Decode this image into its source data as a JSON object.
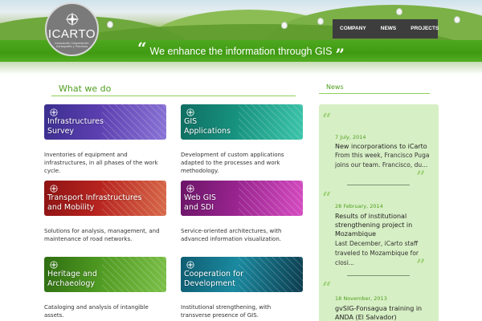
{
  "header": {
    "logo_text": "ICARTO",
    "logo_subtitle": "Innovación Cooperación Cartografía y Procesos",
    "nav": [
      "COMPANY",
      "NEWS",
      "PROJECTS"
    ],
    "slogan": "We enhance the information through GIS",
    "quote_open": "“",
    "quote_close": "”"
  },
  "what_we_do": {
    "title": "What we do",
    "cards": [
      {
        "label": "Infrastructures\nSurvey",
        "description": "Inventories of equipment and infrastructures, in all phases of the work cycle."
      },
      {
        "label": "GIS\nApplications",
        "description": "Development of custom applications adapted to the processes and work methodology."
      },
      {
        "label": "Transport Infrastructures\nand Mobility",
        "description": "Solutions for analysis, management, and maintenance of road networks."
      },
      {
        "label": "Web GIS\nand SDI",
        "description": "Service-oriented architectures, with advanced information visualization."
      },
      {
        "label": "Heritage and\nArchaeology",
        "description": "Cataloging and analysis of intangible assets."
      },
      {
        "label": "Cooperation for\nDevelopment",
        "description": "Institutional strengthening, with transverse presence of GIS."
      }
    ]
  },
  "news": {
    "title": "News",
    "quote_open": "“",
    "quote_close": "”",
    "items": [
      {
        "date": "7 July, 2014",
        "title": "New incorporations to iCarto",
        "excerpt": "From this week, Francisco Puga joins our team. Francisco, du..."
      },
      {
        "date": "28 February, 2014",
        "title": "Results of institutional strengthening project in Mozambique",
        "excerpt": "Last December, iCarto staff traveled to Mozambique for closi..."
      },
      {
        "date": "18 November, 2013",
        "title": "gvSIG-Fonsagua training in ANDA (El Salvador)",
        "excerpt": ""
      }
    ]
  },
  "colors": {
    "accent_green": "#4f9f1e",
    "band_green": "#3f9a12",
    "news_bg": "#d7efc5",
    "nav_bg": "#3d3d3d"
  },
  "icons": {
    "logo": "compass-rose-icon",
    "card": "globe-compass-icon",
    "quote": "quote-mark-icon"
  }
}
